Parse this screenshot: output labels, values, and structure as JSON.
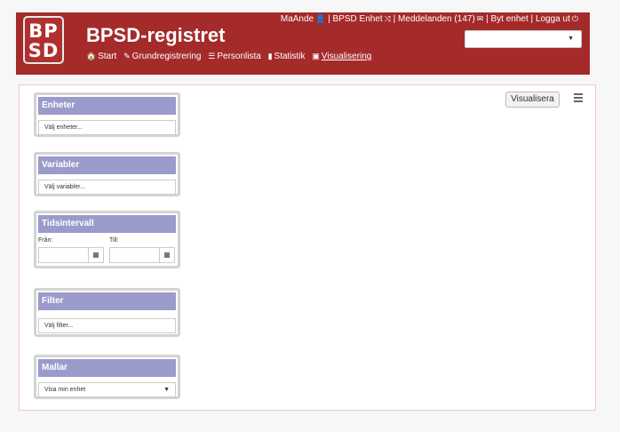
{
  "header": {
    "logo_line1": "BP",
    "logo_line2": "SD",
    "title": "BPSD-registret",
    "user": "MaAnde",
    "unit": "BPSD Enhet",
    "messages": "Meddelanden (147)",
    "switch_unit": "Byt enhet",
    "logout": "Logga ut",
    "separator": "|",
    "unit_select_value": ""
  },
  "nav": [
    {
      "icon": "home-icon",
      "glyph": "🏠",
      "label": "Start"
    },
    {
      "icon": "edit-icon",
      "glyph": "✎",
      "label": "Grundregistrering"
    },
    {
      "icon": "list-icon",
      "glyph": "☰",
      "label": "Personlista"
    },
    {
      "icon": "file-icon",
      "glyph": "▮",
      "label": "Statistik"
    },
    {
      "icon": "picture-icon",
      "glyph": "▣",
      "label": "Visualisering"
    }
  ],
  "panels": {
    "enheter": {
      "title": "Enheter",
      "placeholder": "Välj enheter..."
    },
    "variabler": {
      "title": "Variabler",
      "placeholder": "Välj variabler..."
    },
    "tidsintervall": {
      "title": "Tidsintervall",
      "from_label": "Från:",
      "to_label": "Till:"
    },
    "filter": {
      "title": "Filter",
      "placeholder": "Välj filter..."
    },
    "mallar": {
      "title": "Mallar",
      "value": "Visa min enhet"
    }
  },
  "actions": {
    "visualize": "Visualisera"
  }
}
